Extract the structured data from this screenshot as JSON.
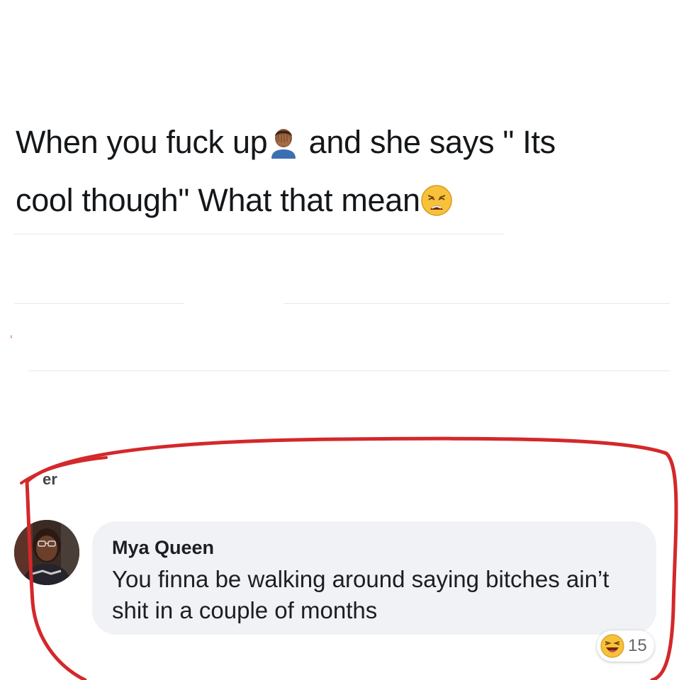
{
  "post": {
    "line1_a": "When you fuck up",
    "line1_b": " and she says \" Its",
    "line2": "cool though\" What that mean",
    "emoji_1": "facepalm-emoji",
    "emoji_2": "weary-face-emoji"
  },
  "ghost_label": "er",
  "comment": {
    "author": "Mya Queen",
    "text": "You finna be walking around saying bitches ain’t shit in a couple of months"
  },
  "reactions": {
    "icon": "laughing-emoji",
    "count": "15"
  },
  "annotation_color": "#d4282a"
}
